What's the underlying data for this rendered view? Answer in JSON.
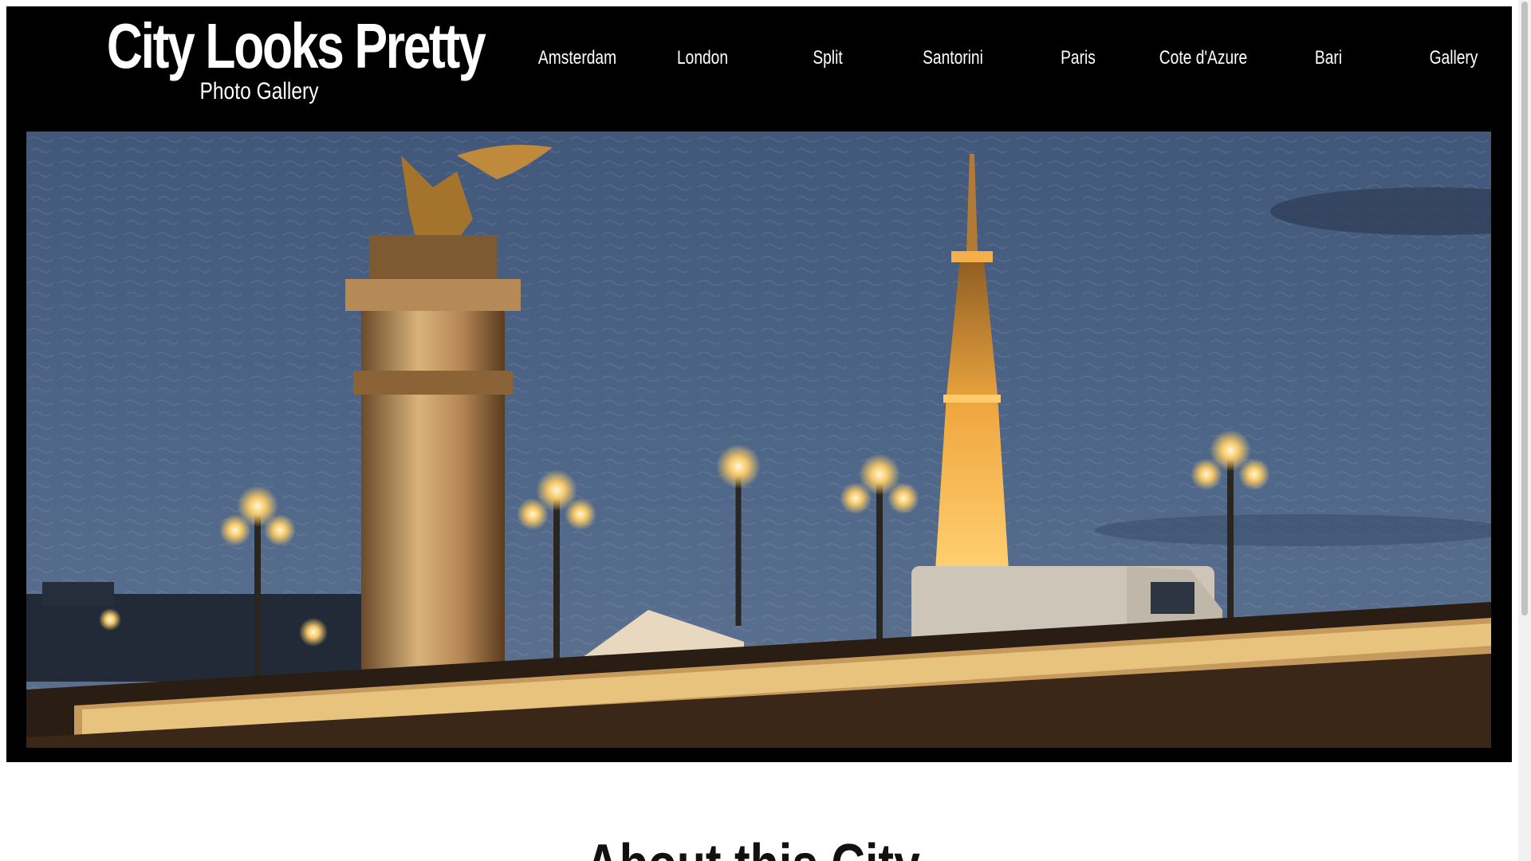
{
  "site": {
    "title": "City Looks Pretty",
    "subtitle": "Photo Gallery"
  },
  "nav": {
    "items": [
      {
        "label": "Amsterdam"
      },
      {
        "label": "London"
      },
      {
        "label": "Split"
      },
      {
        "label": "Santorini"
      },
      {
        "label": "Paris"
      },
      {
        "label": "Cote d'Azure"
      },
      {
        "label": "Bari"
      },
      {
        "label": "Gallery"
      }
    ]
  },
  "main": {
    "section_heading": "About this City"
  },
  "colors": {
    "background": "#ffffff",
    "header_bg": "#000000",
    "nav_text": "#ffffff",
    "sky": "#4b6180",
    "lamp_glow": "#f3c565"
  }
}
